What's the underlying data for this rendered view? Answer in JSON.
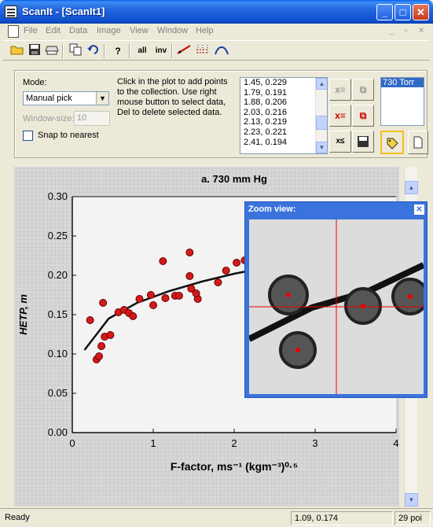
{
  "window": {
    "title": "ScanIt - [ScanIt1]",
    "min_label": "_",
    "max_label": "□",
    "close_label": "✕"
  },
  "menu": [
    "File",
    "Edit",
    "Data",
    "Image",
    "View",
    "Window",
    "Help"
  ],
  "toolbar": {
    "labels": {
      "all": "all",
      "inv": "inv"
    }
  },
  "controls": {
    "mode_label": "Mode:",
    "mode_value": "Manual pick",
    "window_size_label": "Window-size:",
    "window_size_value": "10",
    "snap_label": "Snap to nearest",
    "help_text": "Click in the plot to add points to the collection. Use right mouse button to select data, Del to delete selected data.",
    "points_list": [
      "1.45, 0.229",
      "1.79, 0.191",
      "1.88, 0.206",
      "2.03, 0.216",
      "2.13, 0.219",
      "2.23, 0.221",
      "2.41, 0.194"
    ],
    "collection_name": "730 Torr"
  },
  "zoom_view": {
    "title": "Zoom view:",
    "close_label": "✕"
  },
  "status": {
    "left": "Ready",
    "coords": "1.09, 0.174",
    "count": "29 poi"
  },
  "chart_data": {
    "type": "scatter",
    "title": "a.  730 mm Hg",
    "ylabel": "HETP, m",
    "xlabel": "F-factor, ms⁻¹ (kgm⁻³)⁰·⁵",
    "xlim": [
      0,
      4
    ],
    "ylim": [
      0.0,
      0.3
    ],
    "x_ticks": [
      "0",
      "1",
      "2",
      "3",
      "4"
    ],
    "y_ticks": [
      "0.00",
      "0.05",
      "0.10",
      "0.15",
      "0.20",
      "0.25",
      "0.30"
    ],
    "series": [
      {
        "type": "scatter",
        "values": [
          [
            0.22,
            0.143
          ],
          [
            0.3,
            0.093
          ],
          [
            0.33,
            0.097
          ],
          [
            0.36,
            0.11
          ],
          [
            0.4,
            0.122
          ],
          [
            0.38,
            0.165
          ],
          [
            0.47,
            0.124
          ],
          [
            0.57,
            0.153
          ],
          [
            0.64,
            0.156
          ],
          [
            0.7,
            0.152
          ],
          [
            0.75,
            0.148
          ],
          [
            0.83,
            0.17
          ],
          [
            0.97,
            0.175
          ],
          [
            1.0,
            0.162
          ],
          [
            1.12,
            0.218
          ],
          [
            1.15,
            0.171
          ],
          [
            1.27,
            0.174
          ],
          [
            1.32,
            0.174
          ],
          [
            1.45,
            0.229
          ],
          [
            1.45,
            0.199
          ],
          [
            1.47,
            0.183
          ],
          [
            1.55,
            0.17
          ],
          [
            1.53,
            0.177
          ],
          [
            1.8,
            0.191
          ],
          [
            1.9,
            0.206
          ],
          [
            2.03,
            0.216
          ],
          [
            2.13,
            0.219
          ],
          [
            2.23,
            0.221
          ],
          [
            2.41,
            0.194
          ]
        ]
      },
      {
        "type": "line",
        "values": [
          [
            0.15,
            0.105
          ],
          [
            0.45,
            0.145
          ],
          [
            0.8,
            0.165
          ],
          [
            1.2,
            0.18
          ],
          [
            1.6,
            0.192
          ],
          [
            2.0,
            0.202
          ],
          [
            2.4,
            0.21
          ],
          [
            3.0,
            0.222
          ]
        ]
      }
    ]
  }
}
